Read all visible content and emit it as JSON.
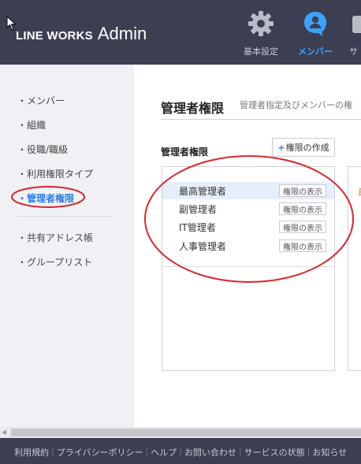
{
  "header": {
    "brand": "LINE WORKS",
    "product": "Admin",
    "nav": [
      {
        "label": "基本設定",
        "icon": "gear-icon"
      },
      {
        "label": "メンバー",
        "icon": "member-icon"
      },
      {
        "label": "サ",
        "icon": "service-icon"
      }
    ]
  },
  "sidebar": {
    "items": [
      {
        "label": "・メンバー"
      },
      {
        "label": "・組織"
      },
      {
        "label": "・役職/職級"
      },
      {
        "label": "・利用権限タイプ"
      },
      {
        "label": "・管理者権限"
      },
      {
        "label": "・共有アドレス帳"
      },
      {
        "label": "・グループリスト"
      }
    ],
    "active_index": 4
  },
  "main": {
    "title": "管理者権限",
    "description": "管理者指定及びメンバーの権",
    "section_title": "管理者権限",
    "create_button": {
      "plus": "+",
      "label": "権限の作成"
    },
    "roles": [
      {
        "name": "最高管理者",
        "button": "権限の表示"
      },
      {
        "name": "副管理者",
        "button": "権限の表示"
      },
      {
        "name": "IT管理者",
        "button": "権限の表示"
      },
      {
        "name": "人事管理者",
        "button": "権限の表示"
      }
    ],
    "selected_role_index": 0,
    "right_panel_mark": "最"
  },
  "footer": {
    "links": [
      "利用規約",
      "プライバシーポリシー",
      "ヘルプ",
      "お問い合わせ",
      "サービスの状態",
      "お知らせ"
    ],
    "separator": "|"
  },
  "colors": {
    "header_bg": "#3c3f52",
    "accent_blue": "#2a7ee6",
    "member_nav_blue": "#3aa3ff",
    "annotation_red": "#d9262c",
    "sidebar_bg": "#f0f1f4",
    "selected_row_bg": "#e6eefa"
  }
}
